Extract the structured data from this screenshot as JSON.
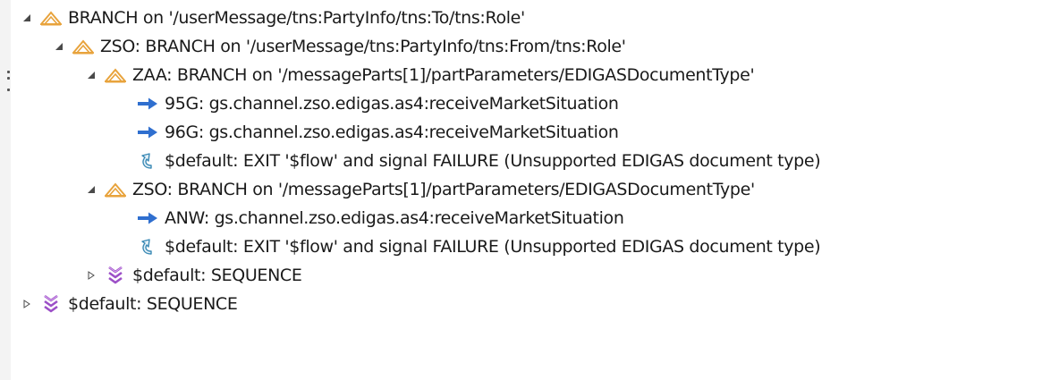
{
  "tree": {
    "rows": [
      {
        "label": "BRANCH on '/userMessage/tns:PartyInfo/tns:To/tns:Role'",
        "icon": "branch-icon",
        "expanded": true
      },
      {
        "label": "ZSO: BRANCH on '/userMessage/tns:PartyInfo/tns:From/tns:Role'",
        "icon": "branch-icon",
        "expanded": true
      },
      {
        "label": "ZAA: BRANCH on '/messageParts[1]/partParameters/EDIGASDocumentType'",
        "icon": "branch-icon",
        "expanded": true
      },
      {
        "label": "95G: gs.channel.zso.edigas.as4:receiveMarketSituation",
        "icon": "invoke-arrow-icon"
      },
      {
        "label": "96G: gs.channel.zso.edigas.as4:receiveMarketSituation",
        "icon": "invoke-arrow-icon"
      },
      {
        "label": "$default: EXIT '$flow' and signal FAILURE (Unsupported EDIGAS document type)",
        "icon": "exit-icon"
      },
      {
        "label": "ZSO: BRANCH on '/messageParts[1]/partParameters/EDIGASDocumentType'",
        "icon": "branch-icon",
        "expanded": true
      },
      {
        "label": "ANW: gs.channel.zso.edigas.as4:receiveMarketSituation",
        "icon": "invoke-arrow-icon"
      },
      {
        "label": "$default: EXIT '$flow' and signal FAILURE (Unsupported EDIGAS document type)",
        "icon": "exit-icon"
      },
      {
        "label": "$default: SEQUENCE",
        "icon": "sequence-icon",
        "expanded": false
      },
      {
        "label": "$default: SEQUENCE",
        "icon": "sequence-icon",
        "expanded": false
      }
    ]
  },
  "colors": {
    "branch_icon": "#e8a33c",
    "invoke_arrow": "#2f6fcf",
    "exit_icon": "#3b8ab5",
    "sequence_icon": "#9c4fc7",
    "twisty": "#4a4a4a"
  }
}
